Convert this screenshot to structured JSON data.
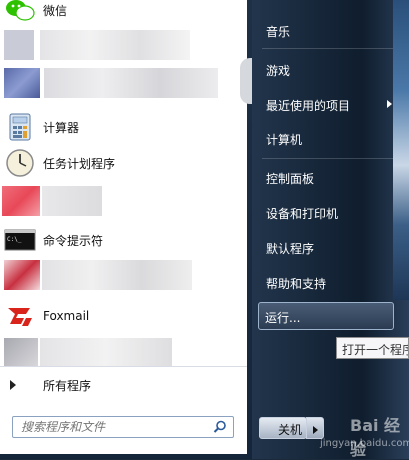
{
  "start_menu": {
    "programs": [
      {
        "label": "微信",
        "icon": "wechat-icon"
      },
      {
        "label": "计算器",
        "icon": "calculator-icon"
      },
      {
        "label": "任务计划程序",
        "icon": "task-scheduler-icon"
      },
      {
        "label": "命令提示符",
        "icon": "command-prompt-icon"
      },
      {
        "label": "Foxmail",
        "icon": "foxmail-icon"
      }
    ],
    "all_programs_label": "所有程序",
    "search": {
      "placeholder": "搜索程序和文件",
      "icon": "search-icon"
    },
    "right_pane": {
      "items": [
        {
          "label": "音乐"
        },
        {
          "label": "游戏"
        },
        {
          "label": "最近使用的项目"
        },
        {
          "label": "计算机"
        },
        {
          "label": "控制面板"
        },
        {
          "label": "设备和打印机"
        },
        {
          "label": "默认程序"
        },
        {
          "label": "帮助和支持"
        }
      ],
      "run_label": "运行...",
      "run_tooltip": "打开一个程序"
    },
    "shutdown_label": "关机"
  },
  "watermark": {
    "brand": "Bai 经验",
    "url": "jingyan.baidu.com"
  },
  "colors": {
    "accent": "#1e3046",
    "menu_bg": "#ffffff",
    "foxmail_red": "#d9241c"
  }
}
